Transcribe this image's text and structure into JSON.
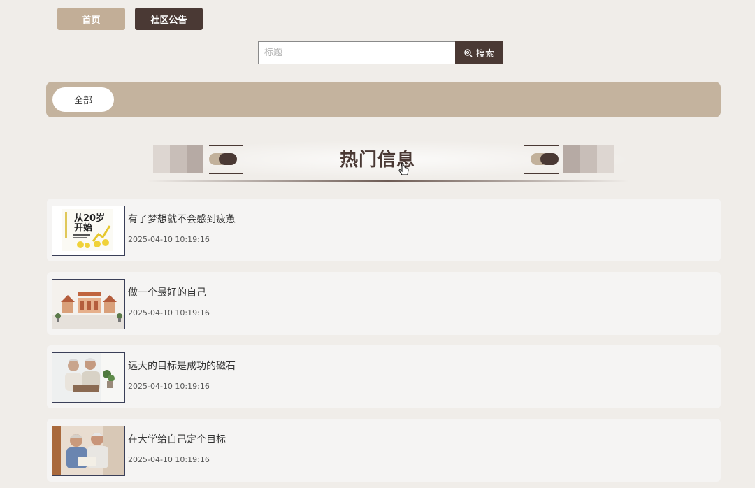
{
  "nav": {
    "home_label": "首页",
    "notice_label": "社区公告"
  },
  "search": {
    "placeholder": "标题",
    "button_label": "搜索"
  },
  "categories": {
    "items": [
      {
        "label": "全部",
        "selected": true
      }
    ]
  },
  "section": {
    "title": "热门信息"
  },
  "articles": [
    {
      "title": "有了梦想就不会感到疲惫",
      "time": "2025-04-10 10:19:16",
      "thumb": "book-cover-image"
    },
    {
      "title": "做一个最好的自己",
      "time": "2025-04-10 10:19:16",
      "thumb": "community-wall-image"
    },
    {
      "title": "远大的目标是成功的磁石",
      "time": "2025-04-10 10:19:16",
      "thumb": "elderly-couple-image"
    },
    {
      "title": "在大学给自己定个目标",
      "time": "2025-04-10 10:19:16",
      "thumb": "elderly-couple-reading-image"
    }
  ],
  "thumb_texts": {
    "book_cover_line1": "从20岁",
    "book_cover_line2": "开始"
  },
  "colors": {
    "accent_dark": "#4a3934",
    "accent_light": "#c2ae97",
    "category_bar": "#c4b39e",
    "background": "#f0ede9"
  }
}
